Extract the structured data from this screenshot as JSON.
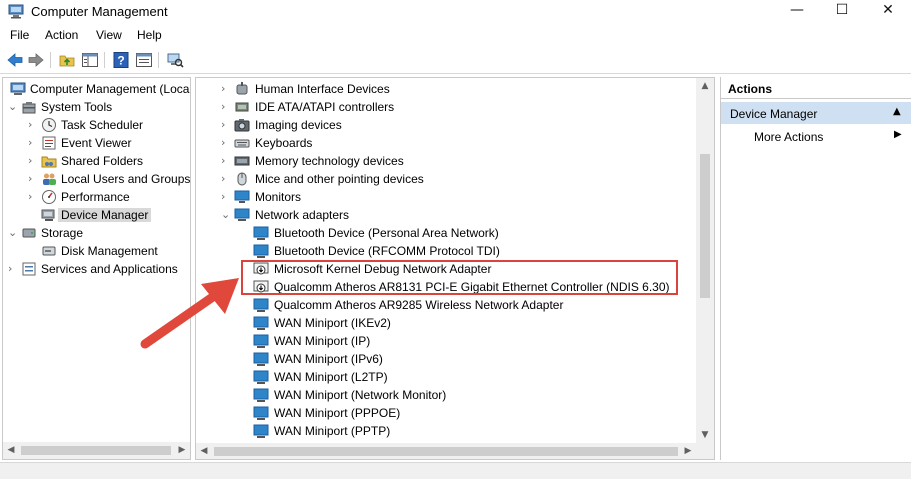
{
  "window": {
    "title": "Computer Management",
    "minimize": "—",
    "maximize": "☐",
    "close": "✕"
  },
  "menu": [
    "File",
    "Action",
    "View",
    "Help"
  ],
  "toolbar": {
    "buttons": [
      "back-arrow-icon",
      "forward-arrow-icon",
      "up-folder-icon",
      "show-hide-tree-icon",
      "help-icon",
      "properties-icon",
      "scan-hardware-icon"
    ]
  },
  "tree": {
    "root": "Computer Management (Local",
    "system_tools": "System Tools",
    "task_scheduler": "Task Scheduler",
    "event_viewer": "Event Viewer",
    "shared_folders": "Shared Folders",
    "local_users": "Local Users and Groups",
    "performance": "Performance",
    "device_manager": "Device Manager",
    "storage": "Storage",
    "disk_management": "Disk Management",
    "services": "Services and Applications"
  },
  "devices": {
    "categories": [
      "Human Interface Devices",
      "IDE ATA/ATAPI controllers",
      "Imaging devices",
      "Keyboards",
      "Memory technology devices",
      "Mice and other pointing devices",
      "Monitors",
      "Network adapters"
    ],
    "network_adapters": [
      "Bluetooth Device (Personal Area Network)",
      "Bluetooth Device (RFCOMM Protocol TDI)",
      "Microsoft Kernel Debug Network Adapter",
      "Qualcomm Atheros AR8131 PCI-E Gigabit Ethernet Controller (NDIS 6.30)",
      "Qualcomm Atheros AR9285 Wireless Network Adapter",
      "WAN Miniport (IKEv2)",
      "WAN Miniport (IP)",
      "WAN Miniport (IPv6)",
      "WAN Miniport (L2TP)",
      "WAN Miniport (Network Monitor)",
      "WAN Miniport (PPPOE)",
      "WAN Miniport (PPTP)"
    ]
  },
  "actions": {
    "header": "Actions",
    "section": "Device Manager",
    "more": "More Actions"
  },
  "colors": {
    "selection": "#cfe0f2",
    "highlight_annotation": "#d9453c",
    "network_icon": "#2e86c9"
  }
}
